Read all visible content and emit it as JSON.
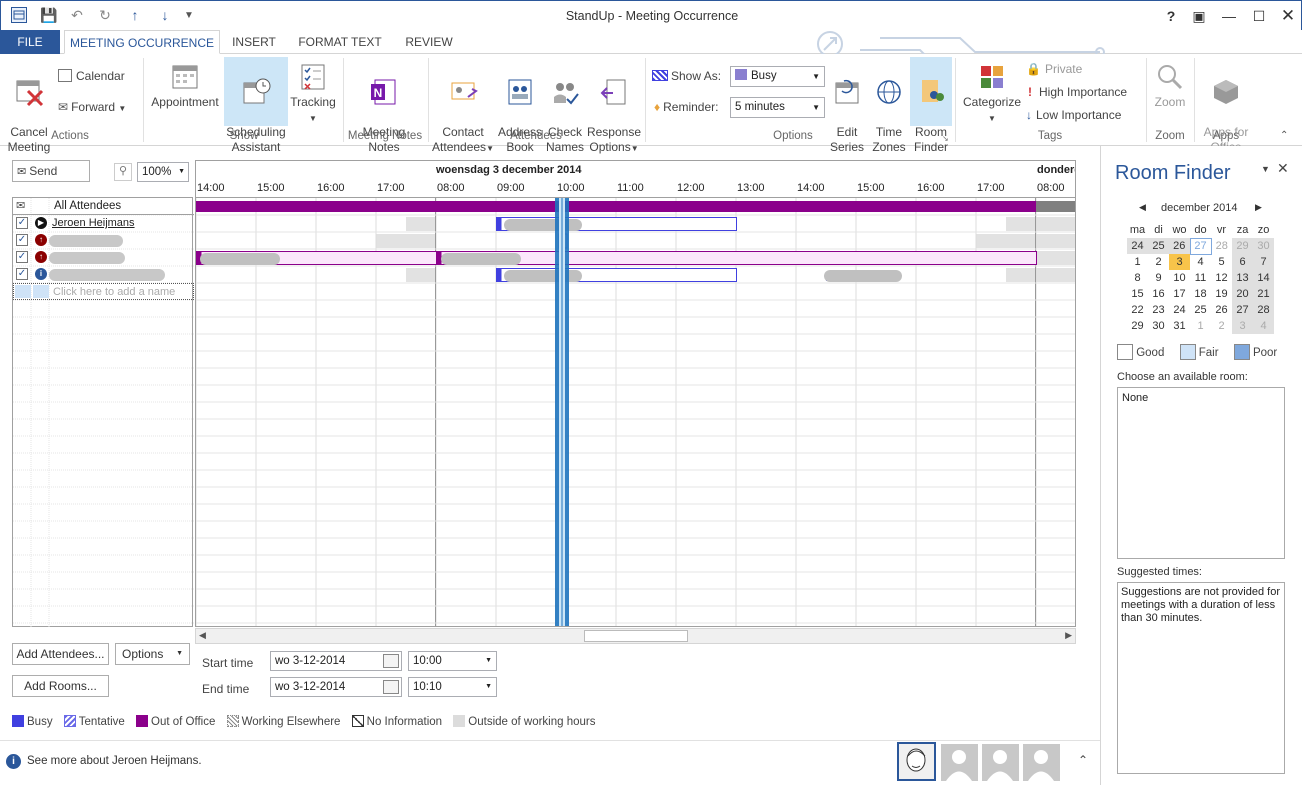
{
  "window": {
    "title": "StandUp - Meeting Occurrence"
  },
  "tabs": [
    {
      "label": "FILE"
    },
    {
      "label": "MEETING OCCURRENCE"
    },
    {
      "label": "INSERT"
    },
    {
      "label": "FORMAT TEXT"
    },
    {
      "label": "REVIEW"
    }
  ],
  "ribbon": {
    "actions": {
      "cancel": "Cancel\nMeeting",
      "calendar": "Calendar",
      "forward": "Forward",
      "group": "Actions"
    },
    "show": {
      "appointment": "Appointment",
      "scheduling": "Scheduling\nAssistant",
      "tracking": "Tracking",
      "group": "Show"
    },
    "notes": {
      "meeting_notes": "Meeting\nNotes",
      "group": "Meeting Notes"
    },
    "attendees": {
      "contact": "Contact\nAttendees",
      "address": "Address\nBook",
      "check": "Check\nNames",
      "response": "Response\nOptions",
      "group": "Attendees"
    },
    "options": {
      "show_as_label": "Show As:",
      "show_as_value": "Busy",
      "reminder_label": "Reminder:",
      "reminder_value": "5 minutes",
      "edit_series": "Edit\nSeries",
      "time_zones": "Time\nZones",
      "room_finder": "Room\nFinder",
      "group": "Options"
    },
    "tags": {
      "categorize": "Categorize",
      "private": "Private",
      "high": "High Importance",
      "low": "Low Importance",
      "group": "Tags"
    },
    "zoom": {
      "zoom": "Zoom",
      "group": "Zoom"
    },
    "apps": {
      "apps": "Apps for\nOffice",
      "group": "Apps"
    }
  },
  "toolbar": {
    "send": "Send",
    "zoom_value": "100%"
  },
  "grid": {
    "date_label": "woensdag 3 december 2014",
    "date_label_next": "donderd",
    "hours": [
      "14:00",
      "15:00",
      "16:00",
      "17:00",
      "08:00",
      "09:00",
      "10:00",
      "11:00",
      "12:00",
      "13:00",
      "14:00",
      "15:00",
      "16:00",
      "17:00",
      "08:00"
    ]
  },
  "attendees": {
    "header": "All Attendees",
    "first": "Jeroen Heijmans",
    "add_placeholder": "Click here to add a name"
  },
  "buttons": {
    "add_attendees": "Add Attendees...",
    "options": "Options",
    "add_rooms": "Add Rooms..."
  },
  "times": {
    "start_label": "Start time",
    "start_date": "wo 3-12-2014",
    "start_time": "10:00",
    "end_label": "End time",
    "end_date": "wo 3-12-2014",
    "end_time": "10:10"
  },
  "legend": [
    "Busy",
    "Tentative",
    "Out of Office",
    "Working Elsewhere",
    "No Information",
    "Outside of working hours"
  ],
  "status": {
    "text": "See more about Jeroen Heijmans."
  },
  "room_finder": {
    "title": "Room Finder",
    "month": "december 2014",
    "weekdays": [
      "ma",
      "di",
      "wo",
      "do",
      "vr",
      "za",
      "zo"
    ],
    "weeks": [
      [
        "24",
        "25",
        "26",
        "27",
        "28",
        "29",
        "30"
      ],
      [
        "1",
        "2",
        "3",
        "4",
        "5",
        "6",
        "7"
      ],
      [
        "8",
        "9",
        "10",
        "11",
        "12",
        "13",
        "14"
      ],
      [
        "15",
        "16",
        "17",
        "18",
        "19",
        "20",
        "21"
      ],
      [
        "22",
        "23",
        "24",
        "25",
        "26",
        "27",
        "28"
      ],
      [
        "29",
        "30",
        "31",
        "1",
        "2",
        "3",
        "4"
      ]
    ],
    "quality": [
      "Good",
      "Fair",
      "Poor"
    ],
    "choose_label": "Choose an available room:",
    "room_value": "None",
    "suggested_label": "Suggested times:",
    "suggested_text": "Suggestions are not provided for meetings with a duration of less than 30 minutes."
  },
  "colors": {
    "accent": "#2b579a",
    "busy": "#4040e0",
    "out_of_office": "#8b008b",
    "meeting": "#1e73be"
  }
}
